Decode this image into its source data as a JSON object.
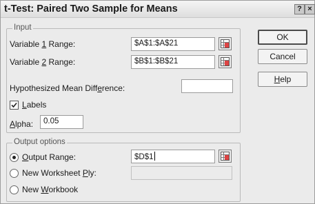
{
  "dialog": {
    "title": "t-Test: Paired Two Sample for Means",
    "help_glyph": "?",
    "close_glyph": "×"
  },
  "input_group": {
    "legend": "Input",
    "variable1": {
      "label_pre": "Variable ",
      "label_key": "1",
      "label_post": " Range:",
      "value": "$A$1:$A$21"
    },
    "variable2": {
      "label_pre": "Variable ",
      "label_key": "2",
      "label_post": " Range:",
      "value": "$B$1:$B$21"
    },
    "hyp_diff": {
      "label_pre": "Hypothesized Mean Diff",
      "label_key": "e",
      "label_post": "rence:",
      "value": ""
    },
    "labels_checkbox": {
      "label_pre": "",
      "label_key": "L",
      "label_post": "abels",
      "checked": true
    },
    "alpha": {
      "label_pre": "",
      "label_key": "A",
      "label_post": "lpha:",
      "value": "0.05"
    }
  },
  "output_group": {
    "legend": "Output options",
    "output_range": {
      "label_pre": "",
      "label_key": "O",
      "label_post": "utput Range:",
      "value": "$D$1",
      "selected": true
    },
    "new_ply": {
      "label_pre": "New Worksheet ",
      "label_key": "P",
      "label_post": "ly:",
      "value": "",
      "selected": false
    },
    "new_workbook": {
      "label_pre": "New ",
      "label_key": "W",
      "label_post": "orkbook",
      "selected": false
    }
  },
  "buttons": {
    "ok": "OK",
    "cancel": "Cancel",
    "help_pre": "",
    "help_key": "H",
    "help_post": "elp"
  },
  "icons": {
    "ref_button": "range-select-icon",
    "check": "checkmark-icon"
  }
}
